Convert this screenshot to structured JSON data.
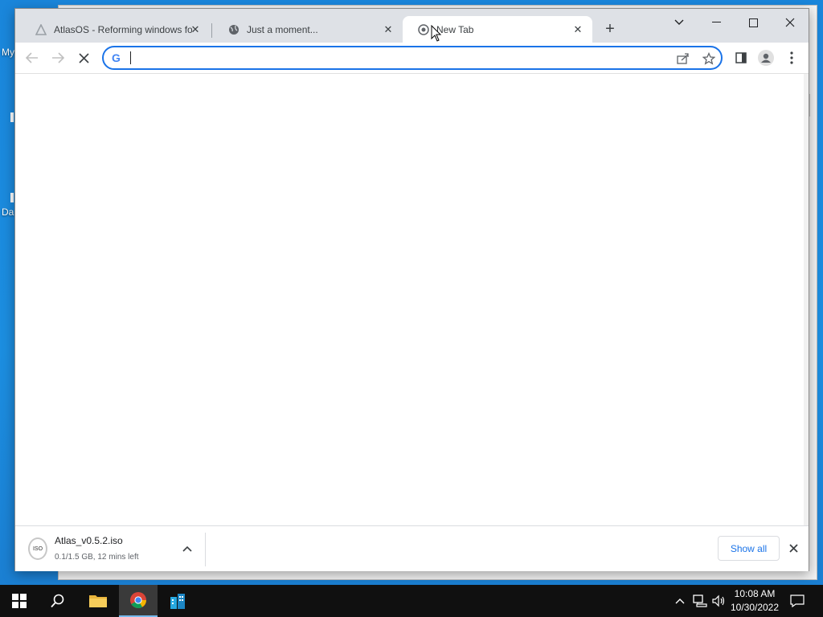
{
  "desktop": {
    "label_top": "My",
    "label_bottom": "Da"
  },
  "browser": {
    "tabs": [
      {
        "title": "AtlasOS - Reforming windows fo",
        "icon": "atlas-logo-icon",
        "active": false
      },
      {
        "title": "Just a moment...",
        "icon": "globe-icon",
        "active": false
      },
      {
        "title": "New Tab",
        "icon": "chrome-icon",
        "active": true
      }
    ],
    "omnibox": {
      "value": "",
      "placeholder": ""
    },
    "window_controls": [
      "tab-search",
      "minimize",
      "maximize",
      "close"
    ]
  },
  "download_shelf": {
    "item": {
      "filename": "Atlas_v0.5.2.iso",
      "icon_text": "ISO",
      "status": "0.1/1.5 GB, 12 mins left"
    },
    "show_all_label": "Show all"
  },
  "taskbar": {
    "apps": [
      "start",
      "search",
      "file-explorer",
      "chrome",
      "app-builder"
    ],
    "active_app": "chrome",
    "time": "10:08 AM",
    "date": "10/30/2022"
  },
  "colors": {
    "accent": "#1a73e8",
    "desktop_bg": "#1a86db",
    "taskbar_bg": "#101010",
    "tabstrip_bg": "#dee1e6"
  }
}
